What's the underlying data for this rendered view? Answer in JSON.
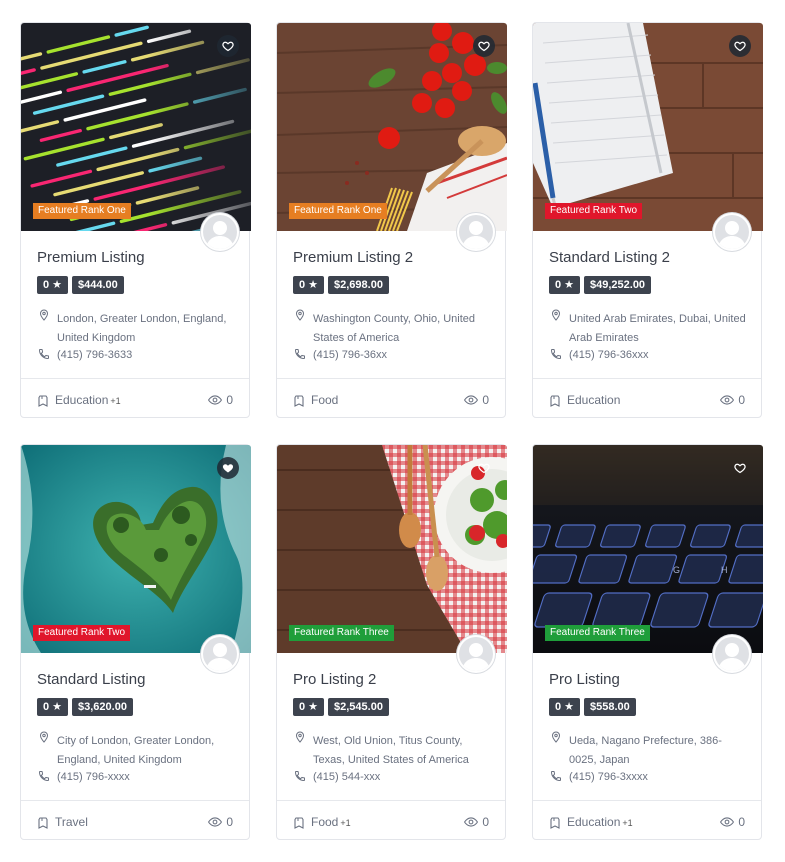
{
  "colors": {
    "rank_one": "#e67e22",
    "rank_two": "#e0162b",
    "rank_three": "#1f9e3a",
    "chip_bg": "#3d434e"
  },
  "listings": [
    {
      "title": "Premium Listing",
      "badge": "Featured Rank One",
      "rating": "0 ★",
      "price": "$444.00",
      "address": "London, Greater London, England, United Kingdom",
      "phone": "(415) 796-3633",
      "category": "Education",
      "category_extra": "+1",
      "views": "0"
    },
    {
      "title": "Premium Listing 2",
      "badge": "Featured Rank One",
      "rating": "0 ★",
      "price": "$2,698.00",
      "address": "Washington County, Ohio, United States of America",
      "phone": "(415) 796-36xx",
      "category": "Food",
      "category_extra": "",
      "views": "0"
    },
    {
      "title": "Standard Listing 2",
      "badge": "Featured Rank Two",
      "rating": "0 ★",
      "price": "$49,252.00",
      "address": "United Arab Emirates, Dubai, United Arab Emirates",
      "phone": "(415) 796-36xxx",
      "category": "Education",
      "category_extra": "",
      "views": "0"
    },
    {
      "title": "Standard Listing",
      "badge": "Featured Rank Two",
      "rating": "0 ★",
      "price": "$3,620.00",
      "address": "City of London, Greater London, England, United Kingdom",
      "phone": "(415) 796-xxxx",
      "category": "Travel",
      "category_extra": "",
      "views": "0"
    },
    {
      "title": "Pro Listing 2",
      "badge": "Featured Rank Three",
      "rating": "0 ★",
      "price": "$2,545.00",
      "address": "West, Old Union, Titus County, Texas, United States of America",
      "phone": "(415) 544-xxx",
      "category": "Food",
      "category_extra": "+1",
      "views": "0"
    },
    {
      "title": "Pro Listing",
      "badge": "Featured Rank Three",
      "rating": "0 ★",
      "price": "$558.00",
      "address": "Ueda, Nagano Prefecture, 386-0025, Japan",
      "phone": "(415) 796-3xxxx",
      "category": "Education",
      "category_extra": "+1",
      "views": "0"
    }
  ]
}
